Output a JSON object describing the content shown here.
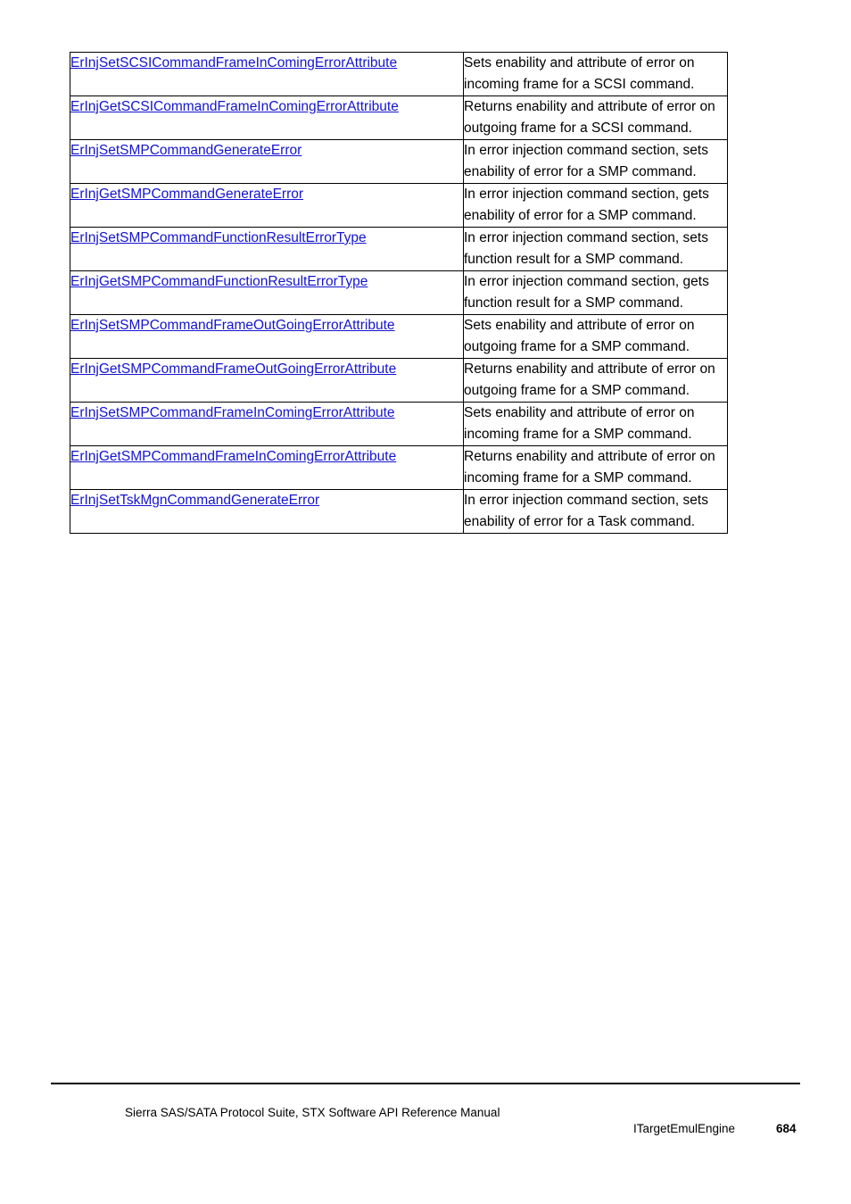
{
  "document": {
    "title": "Sierra SAS/SATA Protocol Suite, STX Software API Reference Manual",
    "chapter": "ITargetEmulEngine",
    "page_number": "684",
    "link_color": "#1414cf",
    "text_color": "#000000",
    "background_color": "#ffffff"
  },
  "table": {
    "rows": [
      {
        "function": "ErInjSetSCSICommandFrameInComingErrorAttribute",
        "description": "Sets enability and attribute of error on incoming frame for a SCSI command."
      },
      {
        "function": "ErInjGetSCSICommandFrameInComingErrorAttribute",
        "description": "Returns enability and attribute of error on outgoing frame for a SCSI command."
      },
      {
        "function": "ErInjSetSMPCommandGenerateError",
        "description": "In error injection command section, sets enability of error for a SMP command."
      },
      {
        "function": "ErInjGetSMPCommandGenerateError",
        "description": "In error injection command section, gets enability of error for a SMP command."
      },
      {
        "function": "ErInjSetSMPCommandFunctionResultErrorType",
        "description": "In error injection command section, sets function result for a SMP command."
      },
      {
        "function": "ErInjGetSMPCommandFunctionResultErrorType",
        "description": "In error injection command section, gets function result for a SMP command."
      },
      {
        "function": "ErInjSetSMPCommandFrameOutGoingErrorAttribute",
        "description": "Sets enability and attribute of error on outgoing frame for a SMP command."
      },
      {
        "function": "ErInjGetSMPCommandFrameOutGoingErrorAttribute",
        "description": "Returns enability and attribute of error on outgoing frame for a SMP command."
      },
      {
        "function": "ErInjSetSMPCommandFrameInComingErrorAttribute",
        "description": "Sets enability and attribute of error on incoming frame for a SMP command."
      },
      {
        "function": "ErInjGetSMPCommandFrameInComingErrorAttribute",
        "description": "Returns enability and attribute of error on incoming frame for a SMP command."
      },
      {
        "function": "ErInjSetTskMgnCommandGenerateError",
        "description": "In error injection command section, sets enability of error for a Task command."
      }
    ]
  }
}
